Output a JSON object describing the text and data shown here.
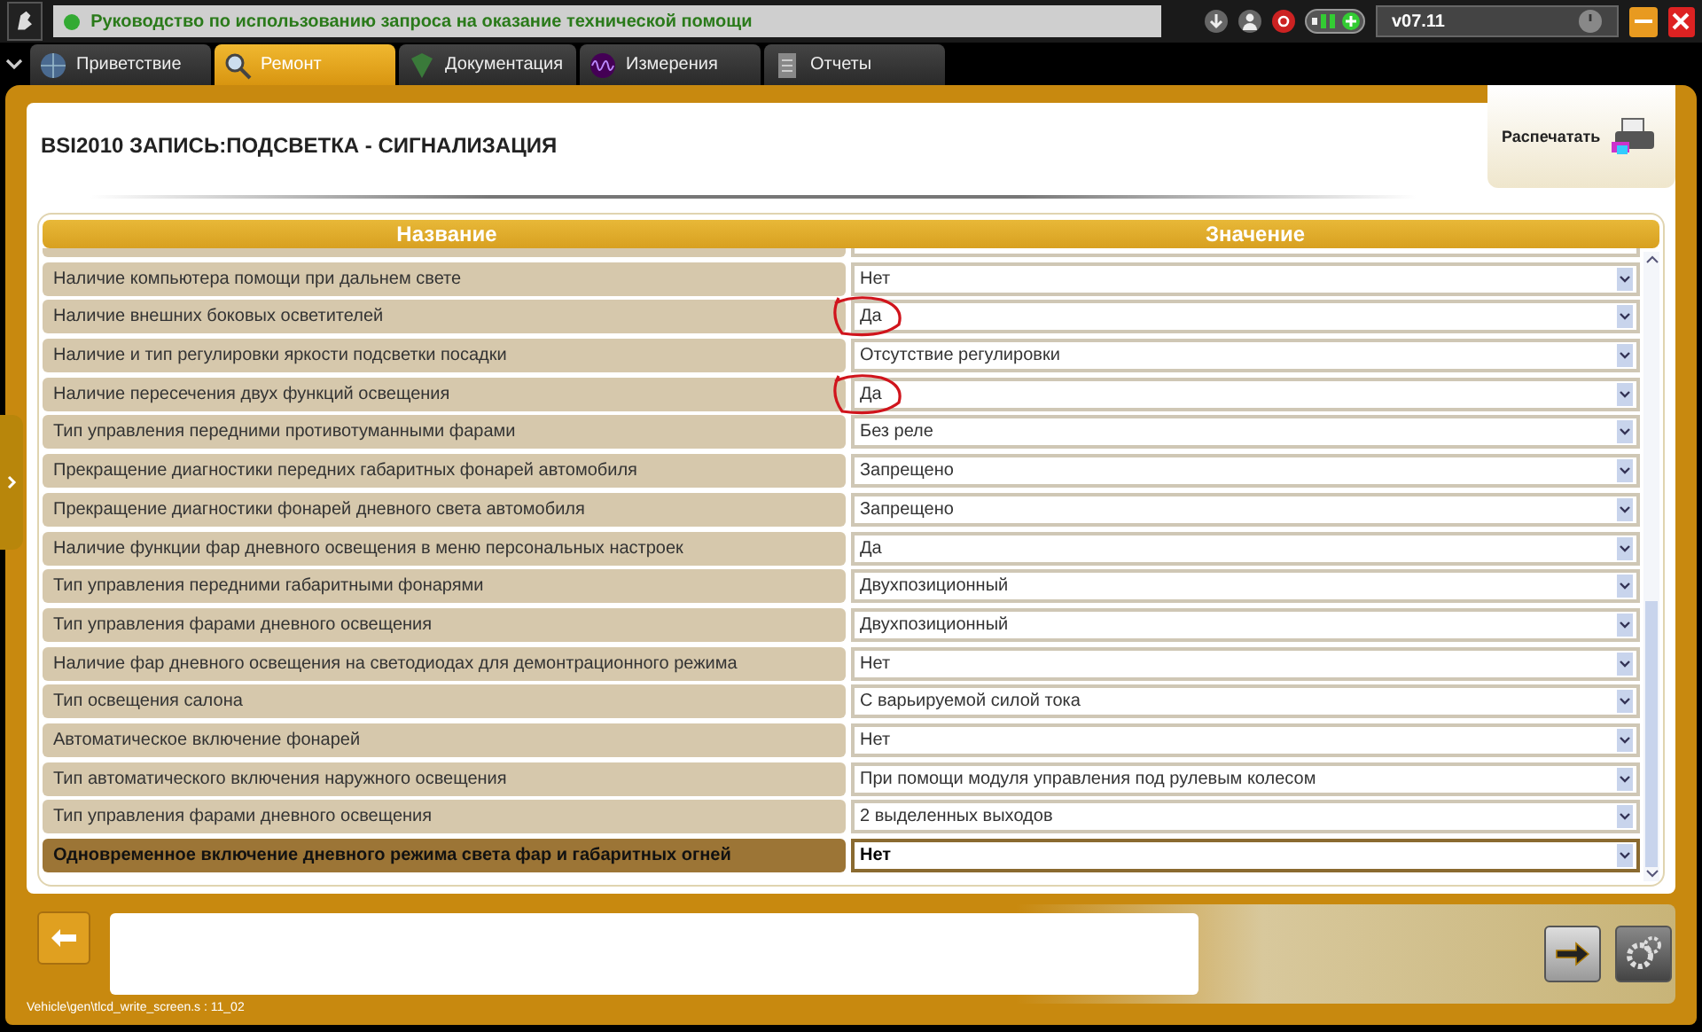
{
  "header": {
    "status_message": "Руководство по использованию запроса на оказание технической помощи",
    "version": "v07.11"
  },
  "tabs": [
    {
      "label": "Приветствие",
      "selected": false
    },
    {
      "label": "Ремонт",
      "selected": true
    },
    {
      "label": "Документация",
      "selected": false
    },
    {
      "label": "Измерения",
      "selected": false
    },
    {
      "label": "Отчеты",
      "selected": false
    }
  ],
  "page_title": "BSI2010  ЗАПИСЬ:ПОДСВЕТКА - СИГНАЛИЗАЦИЯ",
  "print_button": "Распечатать",
  "table": {
    "columns": [
      "Название",
      "Значение"
    ],
    "rows": [
      {
        "name": "Наличие компьютера помощи при дальнем свете",
        "value": "Нет",
        "selected": false,
        "circled": false
      },
      {
        "name": "Наличие внешних боковых осветителей",
        "value": "Да",
        "selected": false,
        "circled": true
      },
      {
        "name": "Наличие и тип регулировки яркости подсветки посадки",
        "value": "Отсутствие регулировки",
        "selected": false,
        "circled": false
      },
      {
        "name": "Наличие пересечения двух функций освещения",
        "value": "Да",
        "selected": false,
        "circled": true
      },
      {
        "name": "Тип управления передними противотуманными фарами",
        "value": "Без реле",
        "selected": false,
        "circled": false
      },
      {
        "name": "Прекращение диагностики передних габаритных фонарей автомобиля",
        "value": "Запрещено",
        "selected": false,
        "circled": false
      },
      {
        "name": "Прекращение диагностики фонарей дневного света автомобиля",
        "value": "Запрещено",
        "selected": false,
        "circled": false
      },
      {
        "name": "Наличие функции фар дневного освещения в меню персональных настроек",
        "value": "Да",
        "selected": false,
        "circled": false
      },
      {
        "name": "Тип управления передними габаритными фонарями",
        "value": "Двухпозиционный",
        "selected": false,
        "circled": false
      },
      {
        "name": "Тип управления фарами дневного освещения",
        "value": "Двухпозиционный",
        "selected": false,
        "circled": false
      },
      {
        "name": "Наличие фар дневного освещения на светодиодах для демонтрационного режима",
        "value": "Нет",
        "selected": false,
        "circled": false
      },
      {
        "name": "Тип освещения салона",
        "value": "С варьируемой силой тока",
        "selected": false,
        "circled": false
      },
      {
        "name": "Автоматическое включение фонарей",
        "value": "Нет",
        "selected": false,
        "circled": false
      },
      {
        "name": "Тип автоматического включения наружного освещения",
        "value": "При помощи модуля управления под рулевым колесом",
        "selected": false,
        "circled": false
      },
      {
        "name": "Тип управления фарами дневного освещения",
        "value": "2 выделенных выходов",
        "selected": false,
        "circled": false
      },
      {
        "name": "Одновременное включение дневного режима света фар и габаритных огней",
        "value": "Нет",
        "selected": true,
        "circled": false
      }
    ]
  },
  "status_bar": {
    "path": "Vehicle\\gen\\tlcd_write_screen.s : 11_02"
  }
}
